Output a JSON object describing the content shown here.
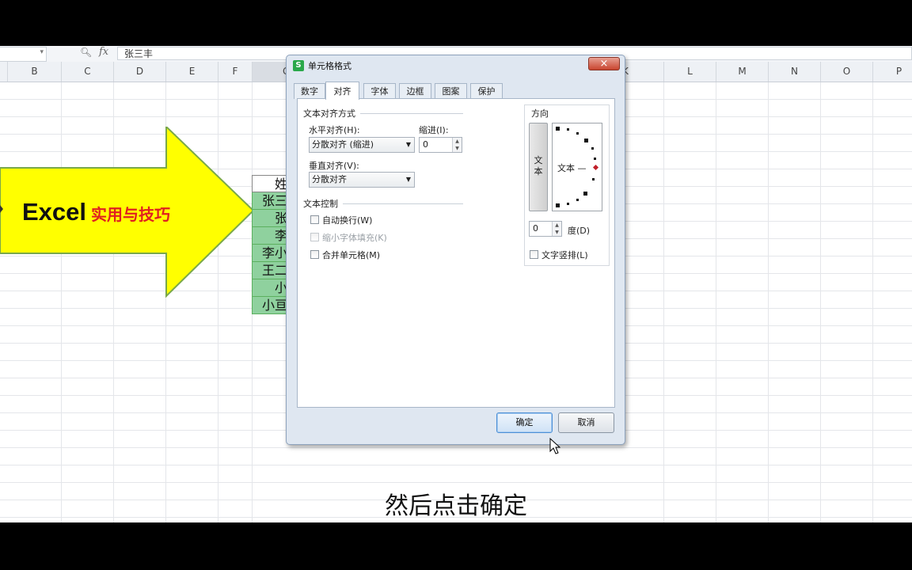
{
  "formula_bar": {
    "fx_label": "fx",
    "cell_value": "张三丰"
  },
  "columns": [
    "B",
    "C",
    "D",
    "E",
    "F",
    "G",
    "K",
    "L",
    "M",
    "N",
    "O",
    "P"
  ],
  "banner": {
    "main": "Excel",
    "sub": "实用与技巧"
  },
  "names_column": {
    "header": "姓",
    "rows": [
      "张三",
      "张",
      "李",
      "李小",
      "王二",
      "小",
      "小亘"
    ]
  },
  "dialog": {
    "title": "单元格格式",
    "close": "×",
    "tabs": [
      "数字",
      "对齐",
      "字体",
      "边框",
      "图案",
      "保护"
    ],
    "active_tab": "对齐",
    "text_align_group": "文本对齐方式",
    "horizontal_label": "水平对齐(H):",
    "horizontal_value": "分散对齐 (缩进)",
    "indent_label": "缩进(I):",
    "indent_value": "0",
    "vertical_label": "垂直对齐(V):",
    "vertical_value": "分散对齐",
    "text_control_group": "文本控制",
    "wrap_text": "自动换行(W)",
    "shrink_fit": "缩小字体填充(K)",
    "merge_cells": "合并单元格(M)",
    "orientation_label": "方向",
    "vertical_text_button": "文本",
    "dial_text": "文本 —",
    "degree_value": "0",
    "degree_label": "度(D)",
    "stack_text": "文字竖排(L)",
    "ok": "确定",
    "cancel": "取消"
  },
  "subtitle": "然后点击确定"
}
